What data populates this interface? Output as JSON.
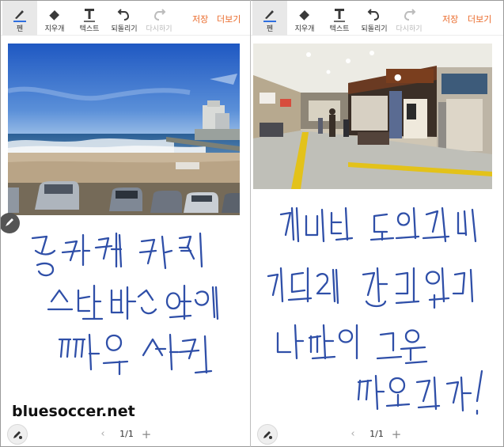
{
  "toolbar": {
    "pen_label": "펜",
    "eraser_label": "지우개",
    "text_label": "텍스트",
    "undo_label": "되돌리기",
    "redo_label": "다시하기",
    "save_label": "저장",
    "more_label": "더보기"
  },
  "left_page": {
    "pager": "1/1"
  },
  "right_page": {
    "pager": "1/1"
  },
  "watermark": "bluesoccer.net",
  "colors": {
    "accent": "#ea6a2a",
    "ink": "#2f4fa8",
    "toolbar_active": "#e8e8e8"
  },
  "icons": [
    "pen-icon",
    "eraser-icon",
    "text-icon",
    "undo-icon",
    "redo-icon",
    "pen-settings-icon",
    "edit-icon"
  ]
}
